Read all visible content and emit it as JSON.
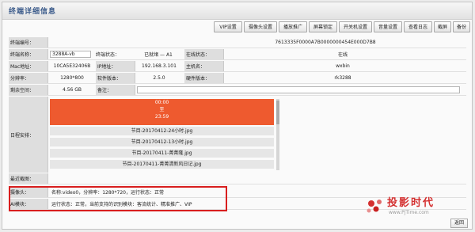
{
  "window": {
    "title": "终端详细信息"
  },
  "toolbar": {
    "buttons": [
      "VIP设置",
      "摄像头设置",
      "播放推广",
      "屏幕锁定",
      "开关机设置",
      "音量设置",
      "查看日志",
      "截屏",
      "备份"
    ]
  },
  "device": {
    "row1": {
      "label": "终端编号：",
      "value": "7613335F0000A7B0000000454E000D7B8"
    },
    "row2": {
      "label": "终端名称：",
      "value": "3288A-vb",
      "label2": "终端状态：",
      "value2": "已就绪 — A1",
      "label3": "在线状态：",
      "value3": "在线"
    },
    "row3": {
      "label": "Mac地址：",
      "value": "10CA5E32406B",
      "label2": "IP地址：",
      "value2": "192.168.3.101",
      "label3": "主机名：",
      "value3": "wxbin"
    },
    "row4": {
      "label": "分辨率：",
      "value": "1280*800",
      "label2": "软件版本：",
      "value2": "2.5.0",
      "label3": "硬件版本：",
      "value3": "rk3288"
    },
    "row5": {
      "label": "剩余空间：",
      "value": "4.56 GB",
      "label2": "备注："
    }
  },
  "schedule": {
    "label": "日程安排：",
    "current": {
      "start": "00:00",
      "separator": "至",
      "end": "23:59"
    },
    "programs": [
      "节目-20170412-24小时.jpg",
      "节目-20170412-13小时.jpg",
      "节目-20170411-菁菁隆.jpg",
      "节目-20170411-菁菁清新风日记.jpg"
    ]
  },
  "latest_shot": {
    "label": "最近截图："
  },
  "camera": {
    "label": "摄像头：",
    "value": "名称:video0，分辨率：1280*720，运行状态：正常"
  },
  "ai_module": {
    "label": "AI模块：",
    "value": "运行状态：正常，当前支持的识别模块：客流统计、精准推广、VIP"
  },
  "watermark": {
    "cn": "投影时代",
    "en": "www.PjTime.com"
  },
  "footer": {
    "back_label": "返回"
  },
  "colors": {
    "accent_red": "#ee5a2f",
    "highlight_border": "#d81e1e",
    "title_blue": "#3a5a8a",
    "label_bg": "#dedede"
  }
}
